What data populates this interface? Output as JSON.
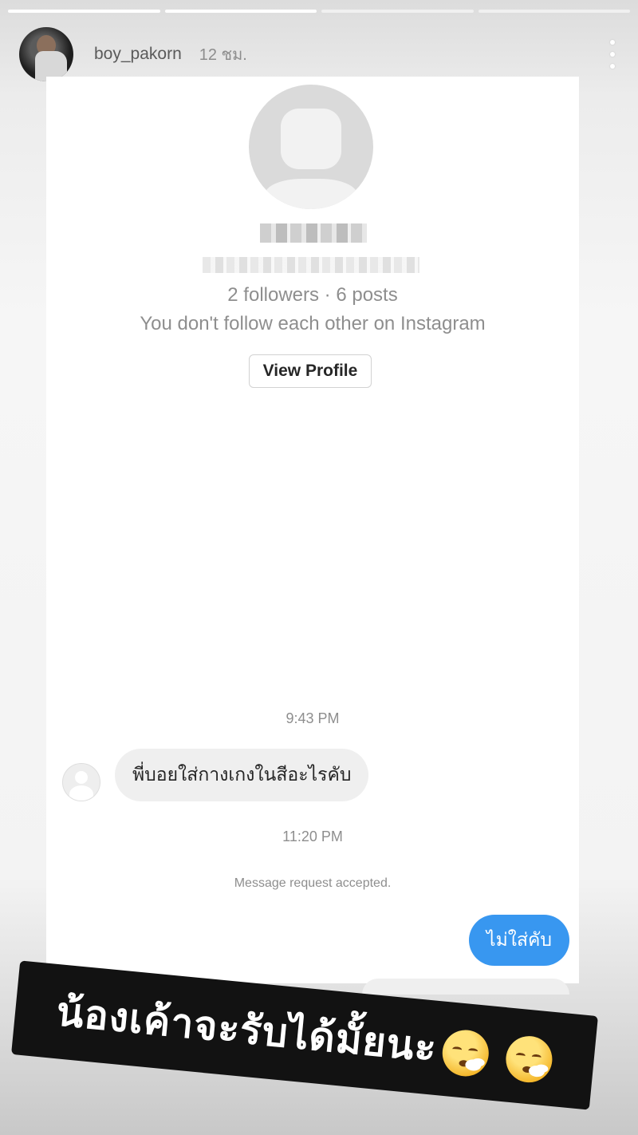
{
  "story": {
    "progress_segments": 4,
    "progress_done": 2,
    "username": "boy_pakorn",
    "time_ago": "12 ชม."
  },
  "profile": {
    "stats": "2 followers · 6 posts",
    "follow_note": "You don't follow each other on Instagram",
    "view_profile_label": "View Profile"
  },
  "chat": {
    "timestamp_1": "9:43 PM",
    "incoming_message": "พี่บอยใส่กางเกงในสีอะไรคับ",
    "timestamp_2": "11:20 PM",
    "request_note": "Message request accepted.",
    "outgoing_message": "ไม่ใส่คับ"
  },
  "caption": {
    "text": "น้องเค้าจะรับได้มั้ยนะ",
    "emoji_icons": [
      "face-exhaling-icon",
      "face-exhaling-icon"
    ]
  },
  "colors": {
    "outgoing_bubble": "#3897f0",
    "incoming_bubble": "#efefef",
    "caption_bg": "#121212"
  }
}
